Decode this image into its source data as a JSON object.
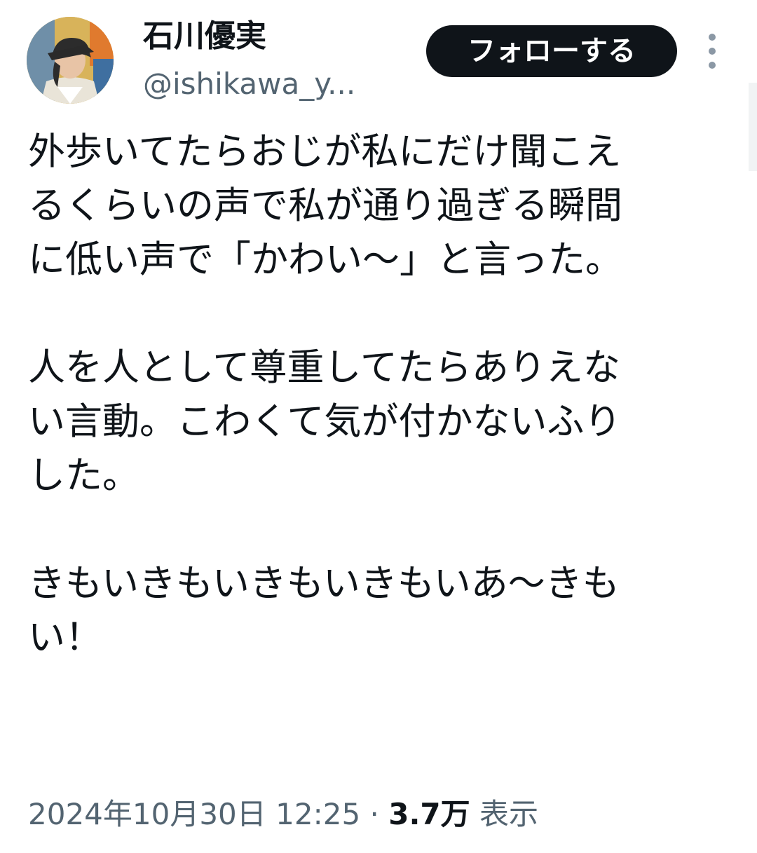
{
  "author": {
    "display_name": "石川優実",
    "handle": "@ishikawa_y..."
  },
  "actions": {
    "follow_label": "フォローする",
    "more_icon": "more-vertical-icon"
  },
  "tweet": {
    "paragraphs": [
      [
        "外歩いてたらおじが私にだけ聞こえ",
        "るくらいの声で私が通り過ぎる瞬間",
        "に低い声で「かわい〜」と言った。"
      ],
      [
        "人を人として尊重してたらありえな",
        "い言動。こわくて気が付かないふり",
        "した。"
      ],
      [
        "きもいきもいきもいきもいあ〜きも",
        "い！"
      ]
    ]
  },
  "meta": {
    "timestamp": "2024年10月30日 12:25",
    "separator": "·",
    "views_count": "3.7万",
    "views_label": "表示"
  },
  "colors": {
    "text_primary": "#0f1419",
    "text_secondary": "#536471",
    "button_bg": "#0f1419",
    "button_text": "#ffffff",
    "icon_gray": "#8b98a5"
  }
}
